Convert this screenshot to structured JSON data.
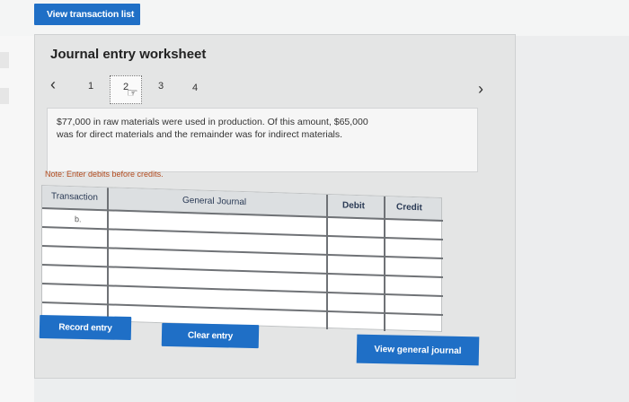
{
  "toolbar": {
    "view_transaction_list": "View transaction list"
  },
  "worksheet": {
    "title": "Journal entry worksheet",
    "tabs": [
      "1",
      "2",
      "3",
      "4"
    ],
    "active_tab": "2",
    "description_line1": "$77,000 in raw materials were used in production. Of this amount, $65,000",
    "description_line2": "was for direct materials and the remainder was for indirect materials.",
    "note": "Note: Enter debits before credits."
  },
  "table": {
    "headers": {
      "transaction": "Transaction",
      "general_journal": "General Journal",
      "debit": "Debit",
      "credit": "Credit"
    },
    "rows": [
      {
        "transaction": "b.",
        "account": "",
        "debit": "",
        "credit": ""
      },
      {
        "transaction": "",
        "account": "",
        "debit": "",
        "credit": ""
      },
      {
        "transaction": "",
        "account": "",
        "debit": "",
        "credit": ""
      },
      {
        "transaction": "",
        "account": "",
        "debit": "",
        "credit": ""
      },
      {
        "transaction": "",
        "account": "",
        "debit": "",
        "credit": ""
      },
      {
        "transaction": "",
        "account": "",
        "debit": "",
        "credit": ""
      }
    ]
  },
  "buttons": {
    "record_entry": "Record entry",
    "clear_entry": "Clear entry",
    "view_general_journal": "View general journal"
  },
  "icons": {
    "prev": "chevron-left-icon",
    "next": "chevron-right-icon",
    "cursor": "hand-pointer-icon"
  },
  "colors": {
    "primary_button": "#1f6fc6",
    "note_text": "#b24a1d"
  }
}
